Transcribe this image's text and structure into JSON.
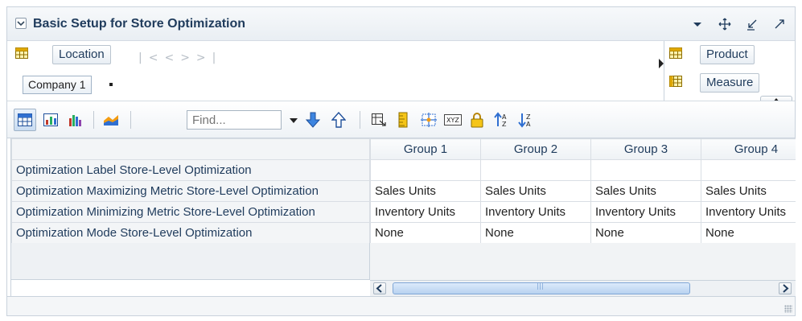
{
  "header": {
    "title": "Basic Setup for Store Optimization",
    "tools": [
      "menu-dropdown-icon",
      "move-icon",
      "restore-icon",
      "maximize-icon"
    ]
  },
  "dimensions": {
    "rows_dimension": "Location",
    "selected_member": "Company 1",
    "pager_icons": [
      "first-page-icon",
      "previous-page-icon",
      "next-page-icon",
      "last-page-icon"
    ],
    "right": [
      "Product",
      "Measure"
    ]
  },
  "toolbar": {
    "find_placeholder": "Find...",
    "icons": [
      "table-view-icon",
      "chart-table-icon",
      "bar-chart-icon",
      "area-chart-icon",
      "down-arrow-icon",
      "up-arrow-icon",
      "pivot-icon",
      "ruler-icon",
      "split-icon",
      "xyz-icon",
      "lock-icon",
      "sort-asc-icon",
      "sort-desc-icon"
    ]
  },
  "grid": {
    "columns": [
      "Group 1",
      "Group 2",
      "Group 3",
      "Group 4"
    ],
    "rows": [
      {
        "label": "Optimization Label Store-Level Optimization",
        "values": [
          "",
          "",
          "",
          ""
        ]
      },
      {
        "label": "Optimization Maximizing Metric Store-Level Optimization",
        "values": [
          "Sales Units",
          "Sales Units",
          "Sales Units",
          "Sales Units"
        ]
      },
      {
        "label": "Optimization Minimizing Metric Store-Level Optimization",
        "values": [
          "Inventory Units",
          "Inventory Units",
          "Inventory Units",
          "Inventory Units"
        ]
      },
      {
        "label": "Optimization Mode Store-Level Optimization",
        "values": [
          "None",
          "None",
          "None",
          "None"
        ]
      }
    ]
  },
  "colors": {
    "title": "#1f3b5c",
    "border": "#c9d2dc",
    "accent_blue": "#2f6fd1"
  }
}
